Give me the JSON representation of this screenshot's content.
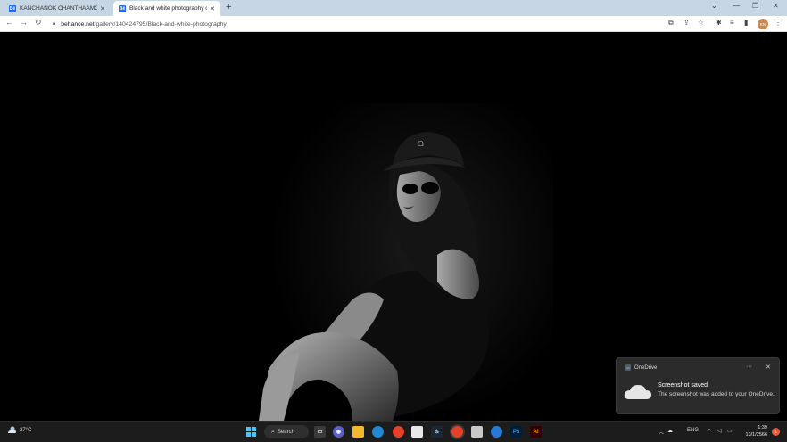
{
  "browser": {
    "tabs": [
      {
        "title": "KANCHANOK CHANTHAAMORN",
        "favicon": "Bē",
        "active": false
      },
      {
        "title": "Black and white photography on",
        "favicon": "Bē",
        "active": true
      }
    ],
    "url_host": "behance.net",
    "url_path": "/gallery/140424795/Black-and-white-photography",
    "icons": [
      "back-icon",
      "forward-icon",
      "reload-icon",
      "lock-icon",
      "translate-icon",
      "share-icon",
      "bookmark-star-icon",
      "extensions-icon",
      "media-icon",
      "sidepanel-icon",
      "menu-icon"
    ],
    "profile_initials": "KN"
  },
  "toast": {
    "app_name": "OneDrive",
    "heading": "Screenshot saved",
    "body": "The screenshot was added to your OneDrive.",
    "more_label": "···",
    "close_label": "✕"
  },
  "taskbar": {
    "weather_temp": "27°C",
    "search_label": "Search",
    "apps": [
      {
        "name": "windows-start",
        "label": ""
      },
      {
        "name": "task-view",
        "label": ""
      },
      {
        "name": "chat",
        "label": ""
      },
      {
        "name": "file-explorer",
        "label": ""
      },
      {
        "name": "edge",
        "label": ""
      },
      {
        "name": "chrome",
        "label": ""
      },
      {
        "name": "steam",
        "label": ""
      },
      {
        "name": "chrome-active",
        "label": ""
      },
      {
        "name": "notepad",
        "label": ""
      },
      {
        "name": "onedrive",
        "label": ""
      },
      {
        "name": "photoshop",
        "label": "Ps"
      },
      {
        "name": "illustrator",
        "label": "Ai"
      }
    ],
    "ime": "ENG",
    "time": "1:39",
    "date": "13/1/2566",
    "notification_count": "1"
  },
  "colors": {
    "tab_strip": "#c6d6e4",
    "behance_blue": "#1769ff",
    "taskbar": "#1c1c1c",
    "toast_bg": "#2b2b2b"
  }
}
